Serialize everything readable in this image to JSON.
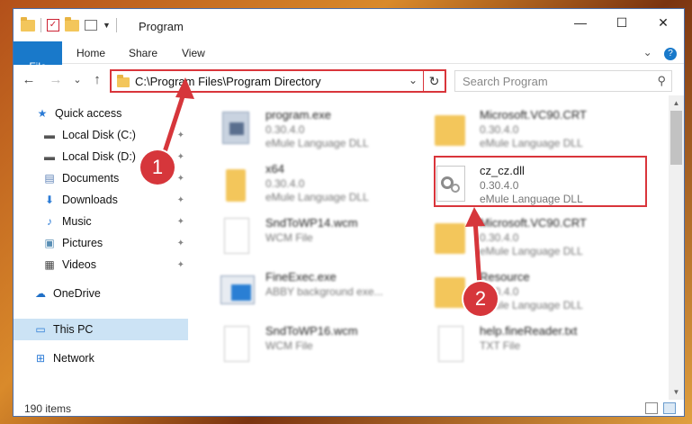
{
  "window": {
    "title": "Program",
    "controls": {
      "minimize": "—",
      "maximize": "☐",
      "close": "✕"
    }
  },
  "ribbon": {
    "tabs": [
      "File",
      "Home",
      "Share",
      "View"
    ],
    "help": "?"
  },
  "nav": {
    "back": "←",
    "forward": "→",
    "recent": "⌄",
    "up": "↑",
    "address": "C:\\Program Files\\Program Directory",
    "refresh": "↻",
    "search_placeholder": "Search Program",
    "search_icon": "⚲"
  },
  "sidebar": {
    "items": [
      {
        "label": "Quick access",
        "icon": "star-icon",
        "glyph": "★",
        "color": "#2b7bd6"
      },
      {
        "label": "Local Disk (C:)",
        "icon": "disk-icon",
        "glyph": "▬",
        "color": "#555555",
        "pinned": true
      },
      {
        "label": "Local Disk (D:)",
        "icon": "disk-icon",
        "glyph": "▬",
        "color": "#555555",
        "pinned": true
      },
      {
        "label": "Documents",
        "icon": "documents-icon",
        "glyph": "▤",
        "color": "#5a7fb5",
        "pinned": true
      },
      {
        "label": "Downloads",
        "icon": "downloads-icon",
        "glyph": "⬇",
        "color": "#2b7bd6",
        "pinned": true
      },
      {
        "label": "Music",
        "icon": "music-icon",
        "glyph": "♪",
        "color": "#2b7bd6",
        "pinned": true
      },
      {
        "label": "Pictures",
        "icon": "pictures-icon",
        "glyph": "▣",
        "color": "#5a8fb5",
        "pinned": true
      },
      {
        "label": "Videos",
        "icon": "videos-icon",
        "glyph": "▦",
        "color": "#444444",
        "pinned": true
      },
      {
        "label": "OneDrive",
        "icon": "cloud-icon",
        "glyph": "☁",
        "color": "#1f6fc6"
      },
      {
        "label": "This PC",
        "icon": "computer-icon",
        "glyph": "▭",
        "color": "#2b7bd6"
      },
      {
        "label": "Network",
        "icon": "network-icon",
        "glyph": "⊞",
        "color": "#2b7bd6"
      }
    ],
    "pin_glyph": "📌"
  },
  "files": [
    {
      "name": "program.exe",
      "line1": "0.30.4.0",
      "line2": "eMule Language DLL",
      "kind": "exe"
    },
    {
      "name": "Microsoft.VC90.CRT",
      "line1": "0.30.4.0",
      "line2": "eMule Language DLL",
      "kind": "folder"
    },
    {
      "name": "x64",
      "line1": "0.30.4.0",
      "line2": "eMule Language DLL",
      "kind": "folder"
    },
    {
      "name": "cz_cz.dll",
      "line1": "0.30.4.0",
      "line2": "eMule Language DLL",
      "kind": "dll"
    },
    {
      "name": "SndToWP14.wcm",
      "line1": "WCM File",
      "line2": "",
      "kind": "doc"
    },
    {
      "name": "Microsoft.VC90.CRT",
      "line1": "0.30.4.0",
      "line2": "eMule Language DLL",
      "kind": "folder"
    },
    {
      "name": "FineExec.exe",
      "line1": "ABBY background exe...",
      "line2": "",
      "kind": "app"
    },
    {
      "name": "Resource",
      "line1": "0.30.4.0",
      "line2": "eMule Language DLL",
      "kind": "folder"
    },
    {
      "name": "SndToWP16.wcm",
      "line1": "WCM File",
      "line2": "",
      "kind": "doc"
    },
    {
      "name": "help.fineReader.txt",
      "line1": "TXT File",
      "line2": "",
      "kind": "doc"
    }
  ],
  "callouts": [
    "1",
    "2"
  ],
  "status": {
    "items": "190 items"
  },
  "colors": {
    "accent": "#1979ca",
    "highlight": "#d9353b",
    "selected": "#cce3f5"
  }
}
